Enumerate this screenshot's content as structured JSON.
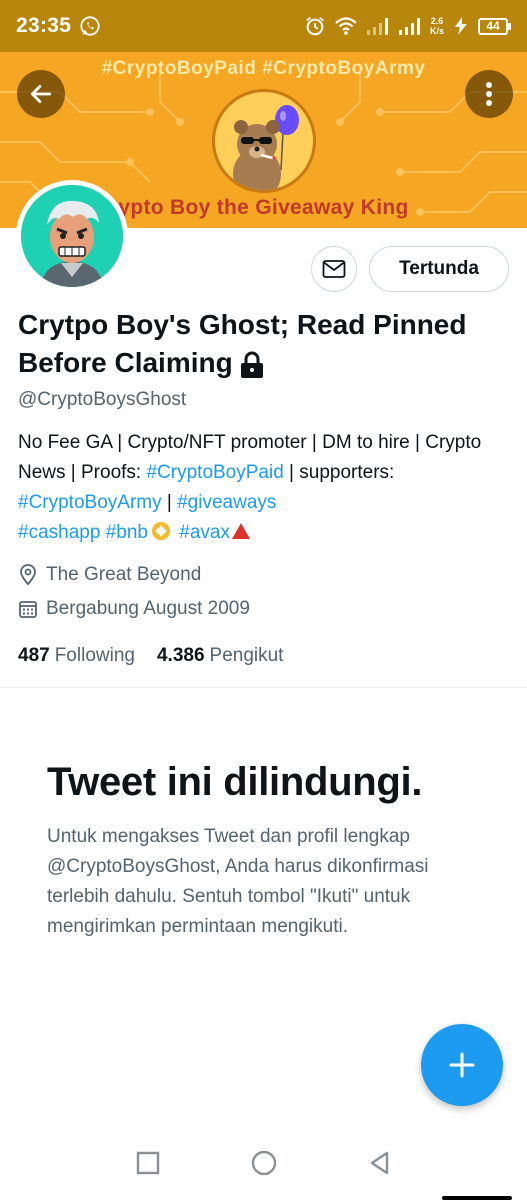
{
  "status_bar": {
    "time": "23:35",
    "net_speed_value": "2.6",
    "net_speed_unit": "K/s",
    "battery": "44",
    "icons": [
      "whatsapp-icon",
      "alarm-icon",
      "wifi-icon",
      "signal-icon",
      "signal-icon",
      "charging-icon",
      "battery-icon"
    ]
  },
  "banner": {
    "hashtags": "#CryptoBoyPaid #CryptoBoyArmy",
    "title": "ypto Boy the Giveaway King",
    "background_color": "#f5a623"
  },
  "actions": {
    "message_icon": "mail-icon",
    "follow_label": "Tertunda"
  },
  "profile": {
    "display_name": "Crytpo Boy's Ghost; Read Pinned Before Claiming",
    "handle": "@CryptoBoysGhost",
    "bio": {
      "line1": "No Fee GA | Crypto/NFT promoter | DM to hire | Crypto News | Proofs: ",
      "tag1": "#CryptoBoyPaid",
      "text2": " | supporters: ",
      "tag2": "#CryptoBoyArmy",
      "text3": " | ",
      "tag3": "#giveaways",
      "tag4": "#cashapp",
      "tag5": "#bnb",
      "tag6": "#avax"
    },
    "location": "The Great Beyond",
    "joined": "Bergabung August 2009",
    "following_count": "487",
    "following_label": "Following",
    "followers_count": "4.386",
    "followers_label": "Pengikut"
  },
  "protected": {
    "title": "Tweet ini dilindungi.",
    "body": "Untuk mengakses Tweet dan profil lengkap @CryptoBoysGhost, Anda harus dikonfirmasi terlebih dahulu. Sentuh tombol \"Ikuti\" untuk mengirimkan permintaan mengikuti."
  },
  "colors": {
    "accent": "#1d9bf0",
    "secondary_text": "#536471",
    "status_bar": "#b8860b"
  }
}
